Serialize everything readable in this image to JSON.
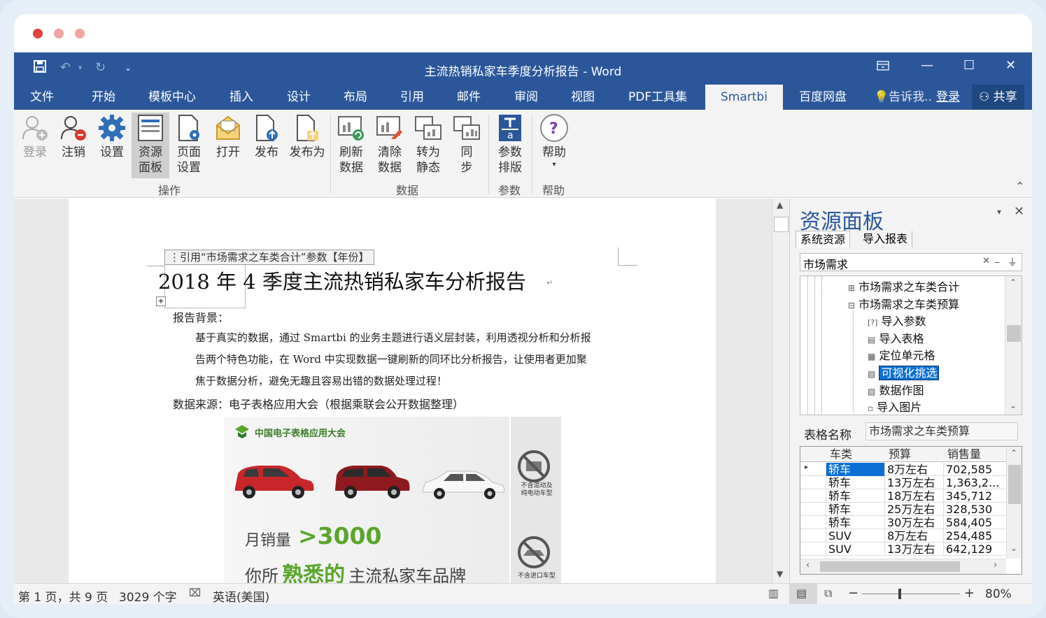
{
  "window": {
    "title": "主流热销私家车季度分析报告 - Word"
  },
  "tabs": [
    "文件",
    "开始",
    "模板中心",
    "插入",
    "设计",
    "布局",
    "引用",
    "邮件",
    "审阅",
    "视图",
    "PDF工具集",
    "Smartbi",
    "百度网盘"
  ],
  "tell_me": "告诉我..",
  "login_link": "登录",
  "share": "共享",
  "ribbon": {
    "buttons": [
      {
        "l1": "登录",
        "l2": ""
      },
      {
        "l1": "注销",
        "l2": ""
      },
      {
        "l1": "设置",
        "l2": ""
      },
      {
        "l1": "资源",
        "l2": "面板"
      },
      {
        "l1": "页面",
        "l2": "设置"
      },
      {
        "l1": "打开",
        "l2": ""
      },
      {
        "l1": "发布",
        "l2": ""
      },
      {
        "l1": "发布为",
        "l2": ""
      },
      {
        "l1": "刷新",
        "l2": "数据"
      },
      {
        "l1": "清除",
        "l2": "数据"
      },
      {
        "l1": "转为",
        "l2": "静态"
      },
      {
        "l1": "同",
        "l2": "步"
      },
      {
        "l1": "参数",
        "l2": "排版"
      },
      {
        "l1": "帮助",
        "l2": "▾"
      }
    ],
    "groups": [
      "操作",
      "数据",
      "参数",
      "帮助"
    ]
  },
  "doc": {
    "field_tag": "引用“市场需求之车类合计”参数【年份】",
    "heading": "2018 年 4 季度主流热销私家车分析报告",
    "bg_label": "报告背景：",
    "para1": "基于真实的数据，通过 Smartbi 的业务主题进行语义层封装，利用透视分析和分析报",
    "para2": "告两个特色功能，在 Word 中实现数据一键刷新的同环比分析报告，让使用者更加聚",
    "para3": "焦于数据分析，避免无趣且容易出错的数据处理过程！",
    "source": "数据来源：电子表格应用大会（根据乘联会公开数据整理）",
    "banner": {
      "logo_text": "中国电子表格应用大会",
      "sales_label": "月销量",
      "sales_value": ">3000",
      "brand_prefix": "你所",
      "brand_highlight": "熟悉的",
      "brand_suffix": "主流私家车品牌",
      "note1": "不含混动及\n纯电动车型",
      "note2": "不含进口车型"
    }
  },
  "panel": {
    "title": "资源面板",
    "tab1": "系统资源",
    "tab2": "导入报表",
    "search_value": "市场需求",
    "tree": [
      {
        "label": "市场需求之车类合计",
        "icon": "⊞"
      },
      {
        "label": "市场需求之车类预算",
        "icon": "⊟"
      },
      {
        "label": "导入参数",
        "icon": "[?]"
      },
      {
        "label": "导入表格",
        "icon": "▤"
      },
      {
        "label": "定位单元格",
        "icon": "▦"
      },
      {
        "label": "可视化挑选",
        "icon": "▧"
      },
      {
        "label": "数据作图",
        "icon": "▨"
      },
      {
        "label": "导入图片",
        "icon": "▫"
      }
    ],
    "table_name_label": "表格名称",
    "table_name_value": "市场需求之车类预算",
    "grid": {
      "headers": [
        "车类",
        "预算",
        "销售量"
      ],
      "rows": [
        [
          "轿车",
          "8万左右",
          "702,585"
        ],
        [
          "轿车",
          "13万左右",
          "1,363,2..."
        ],
        [
          "轿车",
          "18万左右",
          "345,712"
        ],
        [
          "轿车",
          "25万左右",
          "328,530"
        ],
        [
          "轿车",
          "30万左右",
          "584,405"
        ],
        [
          "SUV",
          "8万左右",
          "254,485"
        ],
        [
          "SUV",
          "13万左右",
          "642,129"
        ]
      ]
    }
  },
  "status": {
    "page": "第 1 页，共 9 页",
    "words": "3029 个字",
    "lang": "英语(美国)",
    "zoom": "80%"
  },
  "colors": {
    "accent": "#2b579a",
    "highlight": "#0b6fd6",
    "banner_green": "#5aa52c"
  }
}
